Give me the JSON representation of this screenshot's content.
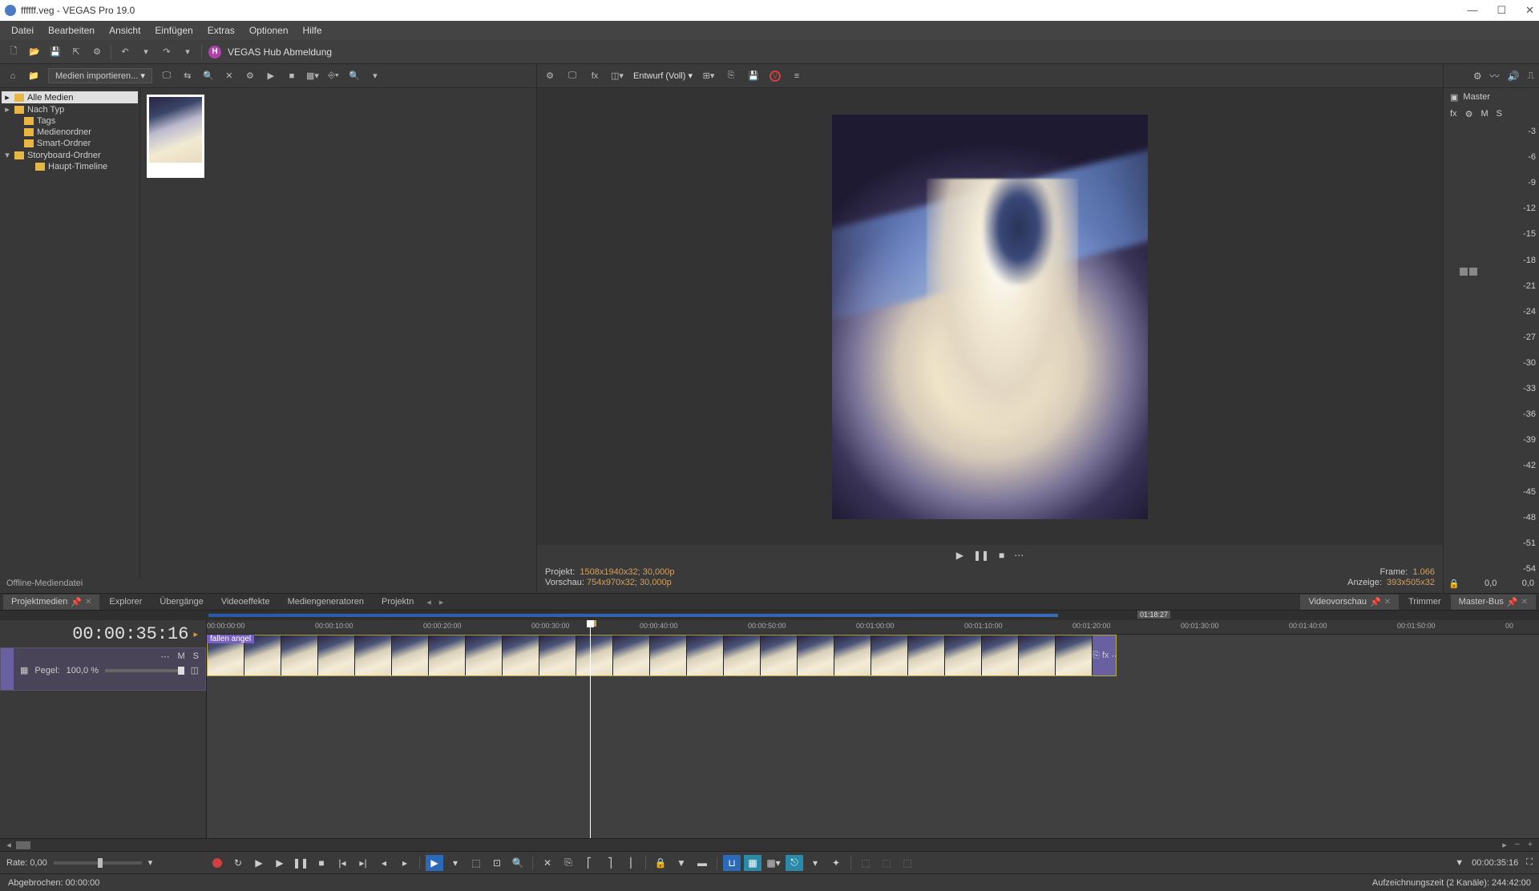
{
  "window": {
    "title": "ffffff.veg - VEGAS Pro 19.0"
  },
  "menu": [
    "Datei",
    "Bearbeiten",
    "Ansicht",
    "Einfügen",
    "Extras",
    "Optionen",
    "Hilfe"
  ],
  "hub": {
    "icon": "H",
    "label": "VEGAS Hub Abmeldung"
  },
  "media_toolbar": {
    "import": "Medien importieren..."
  },
  "tree": {
    "items": [
      {
        "label": "Alle Medien",
        "active": true,
        "indent": 0,
        "exp": "▸"
      },
      {
        "label": "Nach Typ",
        "active": false,
        "indent": 0,
        "exp": "▸"
      },
      {
        "label": "Tags",
        "active": false,
        "indent": 1,
        "exp": ""
      },
      {
        "label": "Medienordner",
        "active": false,
        "indent": 1,
        "exp": ""
      },
      {
        "label": "Smart-Ordner",
        "active": false,
        "indent": 1,
        "exp": ""
      },
      {
        "label": "Storyboard-Ordner",
        "active": false,
        "indent": 0,
        "exp": "▾"
      },
      {
        "label": "Haupt-Timeline",
        "active": false,
        "indent": 2,
        "exp": ""
      }
    ]
  },
  "media_status": "Offline-Mediendatei",
  "preview": {
    "quality": "Entwurf (Voll) ▾",
    "projekt_label": "Projekt:",
    "projekt_val": "1508x1940x32; 30,000p",
    "vorschau_label": "Vorschau:",
    "vorschau_val": "754x970x32; 30,000p",
    "frame_label": "Frame:",
    "frame_val": "1.066",
    "anzeige_label": "Anzeige:",
    "anzeige_val": "393x505x32"
  },
  "tabs": {
    "items": [
      {
        "label": "Projektmedien",
        "close": true,
        "active": true
      },
      {
        "label": "Explorer",
        "close": false,
        "active": false
      },
      {
        "label": "Übergänge",
        "close": false,
        "active": false
      },
      {
        "label": "Videoeffekte",
        "close": false,
        "active": false
      },
      {
        "label": "Mediengeneratoren",
        "close": false,
        "active": false
      },
      {
        "label": "Projektn",
        "close": false,
        "active": false
      }
    ],
    "right": [
      {
        "label": "Videovorschau",
        "close": true
      },
      {
        "label": "Trimmer",
        "close": false
      }
    ],
    "master": "Master-Bus"
  },
  "master": {
    "title": "Master",
    "opts": [
      "fx",
      "⚙",
      "M",
      "S"
    ],
    "scale": [
      "-3",
      "-6",
      "-9",
      "-12",
      "-15",
      "-18",
      "-21",
      "-24",
      "-27",
      "-30",
      "-33",
      "-36",
      "-39",
      "-42",
      "-45",
      "-48",
      "-51",
      "-54"
    ],
    "foot_left": "0,0",
    "foot_right": "0,0"
  },
  "timeline": {
    "timecode": "00:00:35:16",
    "badge": "01:18:27",
    "ruler": [
      "00:00:00:00",
      "00:00:10:00",
      "00:00:20:00",
      "00:00:30:00",
      "00:00:40:00",
      "00:00:50:00",
      "00:01:00:00",
      "00:01:10:00",
      "00:01:20:00",
      "00:01:30:00",
      "00:01:40:00",
      "00:01:50:00",
      "00"
    ],
    "track": {
      "m": "M",
      "s": "S",
      "pegel_label": "Pegel:",
      "pegel_val": "100,0 %"
    },
    "clip_label": "fallen angel"
  },
  "transport": {
    "rate": "Rate: 0,00",
    "tc": "00:00:35:16"
  },
  "status": {
    "left": "Abgebrochen: 00:00:00",
    "right": "Aufzeichnungszeit (2 Kanäle): 244:42:00"
  }
}
